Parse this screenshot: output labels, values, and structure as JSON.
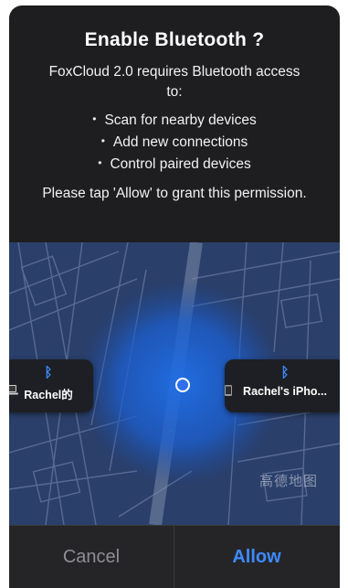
{
  "dialog": {
    "title": "Enable Bluetooth ?",
    "intro": "FoxCloud 2.0 requires Bluetooth access to:",
    "bullets": [
      "Scan for nearby devices",
      "Add new connections",
      "Control paired devices"
    ],
    "outro": "Please tap 'Allow' to grant this permission."
  },
  "map": {
    "watermark": "高德地图",
    "devices": [
      {
        "name": "Rachel的",
        "icon": "laptop-icon"
      },
      {
        "name": "Rachel's iPho...",
        "icon": "phone-icon"
      }
    ],
    "bluetooth_glyph": "ᛒ"
  },
  "buttons": {
    "cancel": "Cancel",
    "allow": "Allow"
  },
  "colors": {
    "dialog_bg": "#1e1e20",
    "accent": "#3d8aff",
    "map_bg": "#2a3f6a"
  }
}
